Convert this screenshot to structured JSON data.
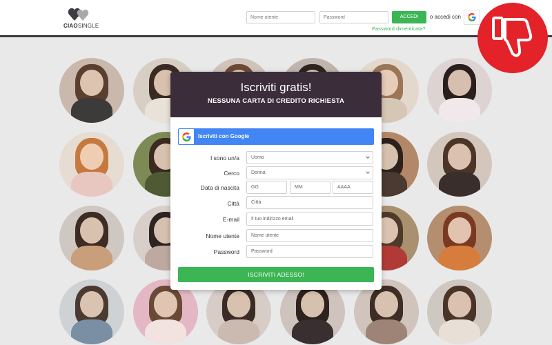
{
  "header": {
    "logo_text_bold": "CIAO",
    "logo_text_light": "SINGLE",
    "username_placeholder": "Nome utente",
    "password_placeholder": "Password",
    "login_button": "ACCEDI",
    "or_text": "o accedi con",
    "forgot_link": "Password dimenticata?"
  },
  "badge": {
    "icon": "thumbs-down-icon",
    "color": "#e32229"
  },
  "modal": {
    "title": "Iscriviti gratis!",
    "subtitle": "NESSUNA CARTA DI CREDITO RICHIESTA",
    "google_button": "Iscriviti con Google",
    "fields": {
      "gender_label": "I sono un/a",
      "gender_value": "Uomo",
      "seek_label": "Cerco",
      "seek_value": "Donna",
      "dob_label": "Data di nascita",
      "dob_day": "GG",
      "dob_month": "MM",
      "dob_year": "AAAA",
      "city_label": "Città",
      "city_placeholder": "Città",
      "email_label": "E-mail",
      "email_placeholder": "Il tuo indirizzo email",
      "username_label": "Nome utente",
      "username_placeholder": "Nome utente",
      "password_label": "Password",
      "password_placeholder": "Password"
    },
    "submit_button": "ISCRIVITI ADESSO!"
  },
  "colors": {
    "accent_green": "#3cb554",
    "google_blue": "#4285f4",
    "modal_header": "#3b2e3a"
  }
}
